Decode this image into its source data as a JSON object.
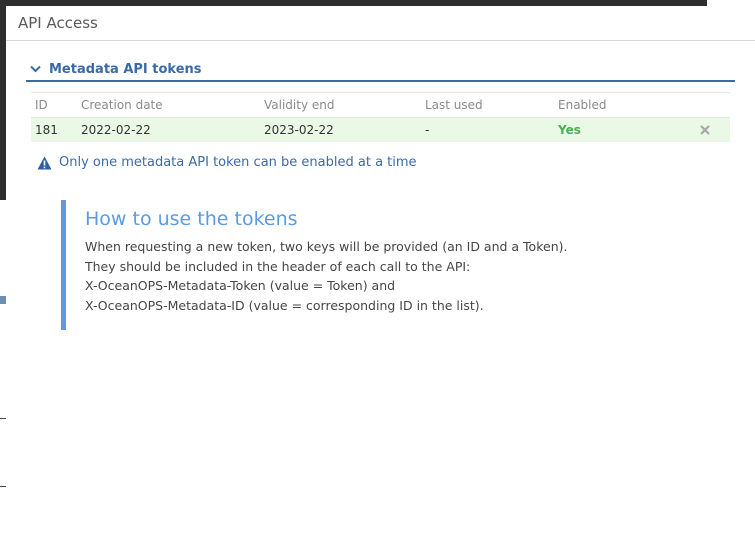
{
  "dialog": {
    "title": "API Access"
  },
  "section": {
    "title": "Metadata API tokens"
  },
  "table": {
    "headers": {
      "id": "ID",
      "created": "Creation date",
      "validity": "Validity end",
      "last_used": "Last used",
      "enabled": "Enabled"
    },
    "rows": [
      {
        "id": "181",
        "created": "2022-02-22",
        "validity": "2023-02-22",
        "last_used": "-",
        "enabled": "Yes",
        "action_icon": "close-icon"
      }
    ]
  },
  "notice": {
    "icon": "warning-icon",
    "text": "Only one metadata API token can be enabled at a time"
  },
  "info": {
    "title": "How to use the tokens",
    "lines": [
      "When requesting a new token, two keys will be provided (an ID and a Token).",
      "They should be included in the header of each call to the API:",
      "X-OceanOPS-Metadata-Token (value = Token) and",
      "X-OceanOPS-Metadata-ID (value = corresponding ID in the list)."
    ]
  },
  "colors": {
    "accent": "#3b6aa8",
    "info_accent": "#5b9be6",
    "enabled_row_bg": "#eaf9e6",
    "enabled_text": "#4caf50"
  }
}
